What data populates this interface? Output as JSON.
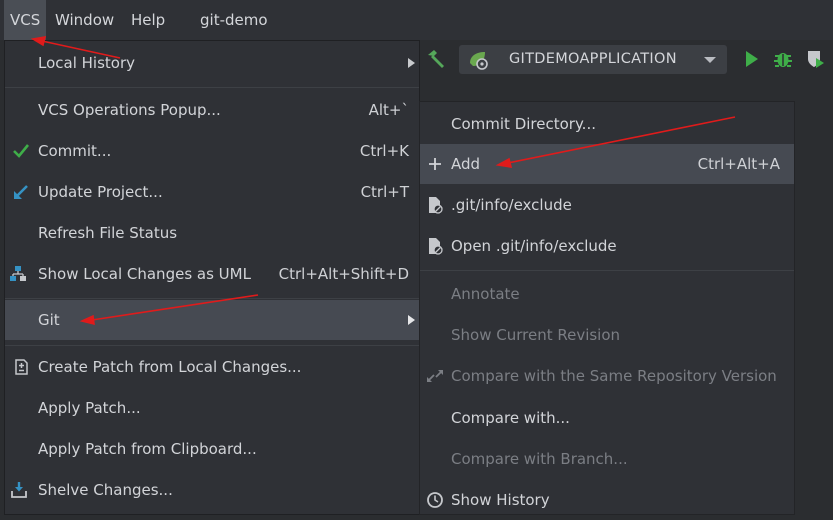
{
  "menubar": {
    "vcs": "VCS",
    "window": "Window",
    "help": "Help",
    "project": "git-demo"
  },
  "toolbar": {
    "run_config": "GITDEMOAPPLICATION"
  },
  "vcs_menu": {
    "local_history": "Local History",
    "operations_popup": "VCS Operations Popup...",
    "operations_popup_sc": "Alt+`",
    "commit": "Commit...",
    "commit_sc": "Ctrl+K",
    "update_project": "Update Project...",
    "update_project_sc": "Ctrl+T",
    "refresh_status": "Refresh File Status",
    "show_changes_uml": "Show Local Changes as UML",
    "show_changes_uml_sc": "Ctrl+Alt+Shift+D",
    "git": "Git",
    "create_patch": "Create Patch from Local Changes...",
    "apply_patch": "Apply Patch...",
    "apply_patch_clipboard": "Apply Patch from Clipboard...",
    "shelve_changes": "Shelve Changes..."
  },
  "git_menu": {
    "commit_directory": "Commit Directory...",
    "add": "Add",
    "add_sc": "Ctrl+Alt+A",
    "git_info_exclude": ".git/info/exclude",
    "open_git_info_exclude": "Open .git/info/exclude",
    "annotate": "Annotate",
    "show_current_revision": "Show Current Revision",
    "compare_same_repo": "Compare with the Same Repository Version",
    "compare_with": "Compare with...",
    "compare_with_branch": "Compare with Branch...",
    "show_history": "Show History"
  },
  "colors": {
    "arrow": "#e01b1b",
    "run_green": "#3fae49",
    "commit_check": "#3fae49",
    "update_arrow": "#3592c4"
  }
}
